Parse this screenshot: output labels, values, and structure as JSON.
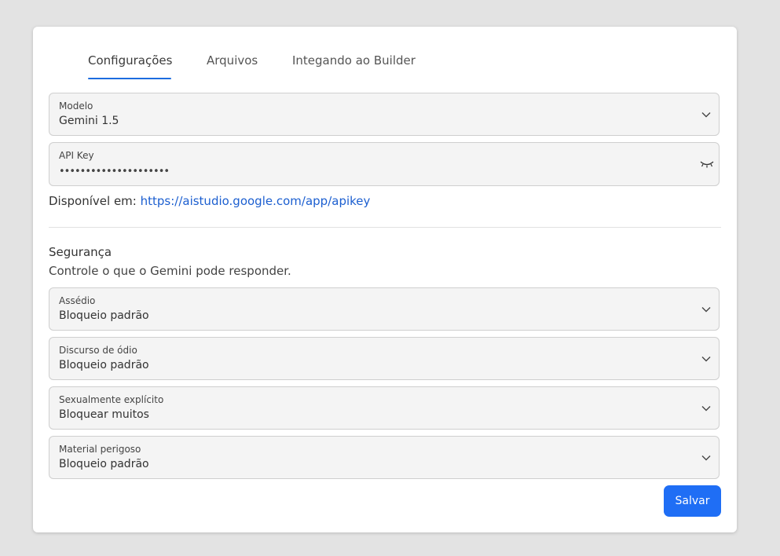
{
  "tabs": [
    {
      "label": "Configurações",
      "active": true
    },
    {
      "label": "Arquivos",
      "active": false
    },
    {
      "label": "Integando ao Builder",
      "active": false
    }
  ],
  "model_select": {
    "label": "Modelo",
    "value": "Gemini 1.5"
  },
  "api_key": {
    "label": "API Key",
    "masked_value": "•••••••••••••••••••••"
  },
  "availability": {
    "prefix": "Disponível em: ",
    "link": "https://aistudio.google.com/app/apikey"
  },
  "security": {
    "title": "Segurança",
    "description": "Controle o que o Gemini pode responder.",
    "filters": [
      {
        "label": "Assédio",
        "value": "Bloqueio padrão"
      },
      {
        "label": "Discurso de ódio",
        "value": "Bloqueio padrão"
      },
      {
        "label": "Sexualmente explícito",
        "value": "Bloquear muitos"
      },
      {
        "label": "Material perigoso",
        "value": "Bloqueio padrão"
      }
    ]
  },
  "save_button": {
    "label": "Salvar"
  },
  "icons": {
    "select": "chevron-down-icon",
    "visibility": "eye-closed-icon"
  },
  "colors": {
    "accent": "#1f6ef5",
    "link": "#1c5fd0",
    "background": "#e3e3e3",
    "field": "#f4f4f4"
  }
}
